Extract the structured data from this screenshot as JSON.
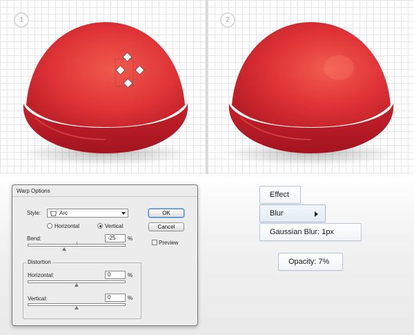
{
  "steps": {
    "step1": "1",
    "step2": "2"
  },
  "colors": {
    "dome_top": "#ee4b44",
    "dome_base": "#c8232c",
    "dome_rim": "#a4141c",
    "grid": "#e6e6e6"
  },
  "warp_dialog": {
    "title": "Warp Options",
    "style_label": "Style:",
    "style_value": "Arc",
    "horizontal_radio": "Horizontal",
    "vertical_radio": "Vertical",
    "orientation_selected": "Vertical",
    "bend_label": "Bend:",
    "bend_value": "-25",
    "bend_unit": "%",
    "bend_percent": -25,
    "distortion_label": "Distortion",
    "horizontal_label": "Horizontal:",
    "horizontal_value": "0",
    "horizontal_unit": "%",
    "vertical_label": "Vertical:",
    "vertical_value": "0",
    "vertical_unit": "%",
    "ok_label": "OK",
    "cancel_label": "Cancel",
    "preview_label": "Preview",
    "preview_checked": false
  },
  "menu": {
    "effect": "Effect",
    "blur": "Blur",
    "gaussian": "Gaussian Blur: 1px",
    "opacity": "Opacity: 7%"
  }
}
